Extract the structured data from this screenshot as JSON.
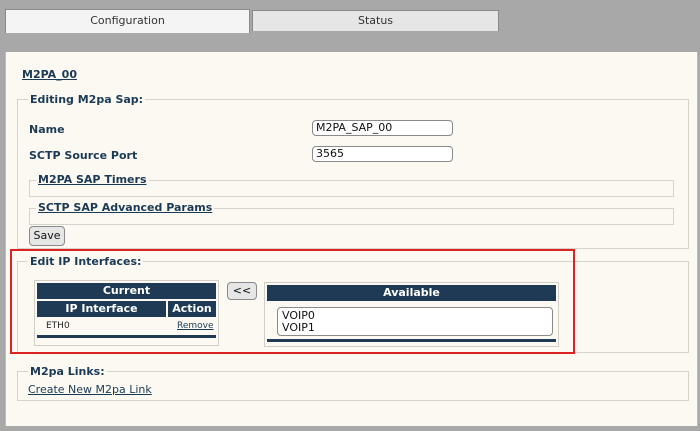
{
  "tabs": [
    {
      "label": "Configuration",
      "active": true
    },
    {
      "label": "Status",
      "active": false
    }
  ],
  "page": {
    "title": "M2PA_00"
  },
  "editing_sap": {
    "legend": "Editing M2pa Sap:",
    "name_label": "Name",
    "name_value": "M2PA_SAP_00",
    "port_label": "SCTP Source Port",
    "port_value": "3565",
    "timers_link": "M2PA SAP Timers",
    "advanced_link": "SCTP SAP Advanced Params",
    "save_label": "Save"
  },
  "ip_interfaces": {
    "legend": "Edit IP Interfaces:",
    "current_header": "Current",
    "col_interface": "IP Interface",
    "col_action": "Action",
    "rows": [
      {
        "interface": "ETH0",
        "action": "Remove"
      }
    ],
    "move_button": "<<",
    "available_header": "Available",
    "available_items": [
      "VOIP0",
      "VOIP1"
    ]
  },
  "links": {
    "legend": "M2pa Links:",
    "create_link": "Create New M2pa Link"
  },
  "colors": {
    "header_bg": "#1e3a55",
    "highlight_border": "#dd2222",
    "panel_bg": "#fbf9f1"
  }
}
